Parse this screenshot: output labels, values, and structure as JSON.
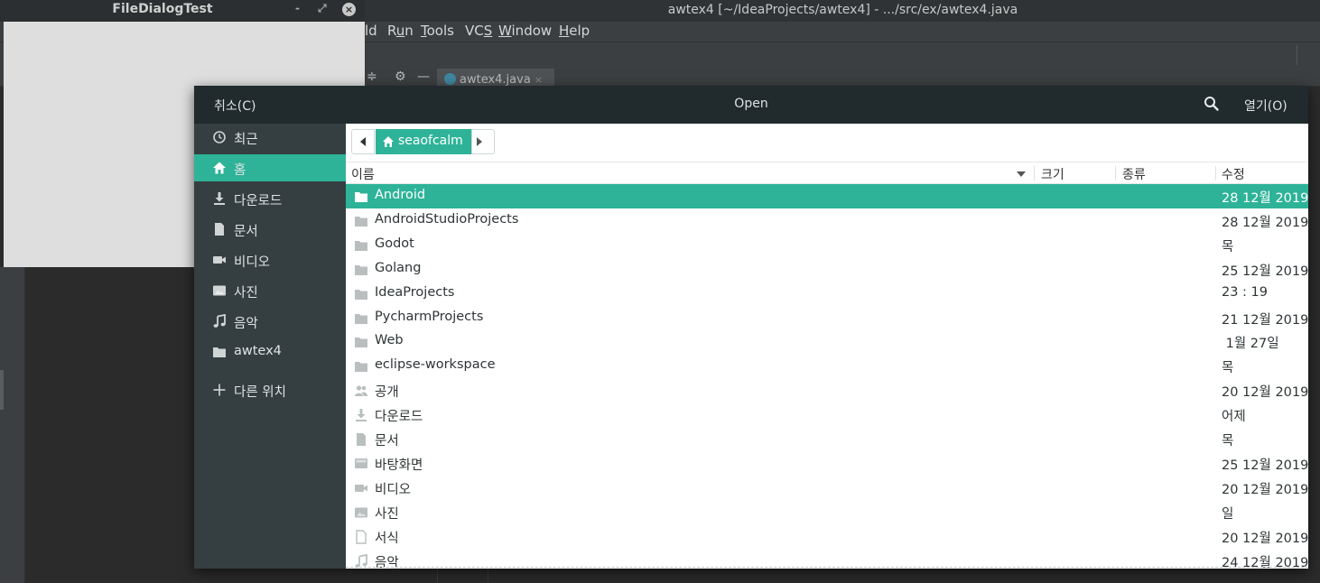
{
  "ide": {
    "title": "awtex4 [~/IdeaProjects/awtex4] - .../src/ex/awtex4.java",
    "menu": [
      {
        "label": "ld",
        "underline": ""
      },
      {
        "pre": "R",
        "u": "u",
        "post": "n"
      },
      {
        "pre": "",
        "u": "T",
        "post": "ools"
      },
      {
        "pre": "VC",
        "u": "S",
        "post": ""
      },
      {
        "pre": "",
        "u": "W",
        "post": "indow"
      },
      {
        "pre": "",
        "u": "H",
        "post": "elp"
      }
    ],
    "menu_labels": {
      "build_fragment": "ld",
      "run": "Run",
      "tools": "Tools",
      "vcs": "VCS",
      "window": "Window",
      "help": "Help"
    },
    "editor_tab": "awtex4.java",
    "editor_tab_close": "×"
  },
  "test_window": {
    "title": "FileDialogTest",
    "minimize": "-",
    "restore": "⤢",
    "close": "×"
  },
  "dialog": {
    "cancel_label": "취소(C)",
    "title": "Open",
    "open_label": "열기(O)",
    "sidebar": [
      {
        "label": "최근",
        "icon": "clock-icon"
      },
      {
        "label": "홈",
        "icon": "home-icon",
        "selected": true
      },
      {
        "label": "다운로드",
        "icon": "download-icon"
      },
      {
        "label": "문서",
        "icon": "document-icon"
      },
      {
        "label": "비디오",
        "icon": "video-icon"
      },
      {
        "label": "사진",
        "icon": "image-icon"
      },
      {
        "label": "음악",
        "icon": "music-icon"
      },
      {
        "label": "awtex4",
        "icon": "folder-icon"
      },
      {
        "label": "다른 위치",
        "icon": "plus-icon"
      }
    ],
    "pathbar": {
      "home_label": "seaofcalm"
    },
    "columns": {
      "name": "이름",
      "size": "크기",
      "type": "종류",
      "modified": "수정"
    },
    "files": [
      {
        "name": "Android",
        "modified": "28 12월 2019",
        "icon": "folder-icon",
        "selected": true
      },
      {
        "name": "AndroidStudioProjects",
        "modified": "28 12월 2019",
        "icon": "folder-icon"
      },
      {
        "name": "Godot",
        "modified": "목",
        "icon": "folder-icon"
      },
      {
        "name": "Golang",
        "modified": "25 12월 2019",
        "icon": "folder-icon"
      },
      {
        "name": "IdeaProjects",
        "modified": "23 : 19",
        "icon": "folder-icon"
      },
      {
        "name": "PycharmProjects",
        "modified": "21 12월 2019",
        "icon": "folder-icon"
      },
      {
        "name": "Web",
        "modified": " 1월 27일",
        "icon": "folder-icon"
      },
      {
        "name": "eclipse-workspace",
        "modified": "목",
        "icon": "folder-icon"
      },
      {
        "name": "공개",
        "modified": "20 12월 2019",
        "icon": "public-share-icon"
      },
      {
        "name": "다운로드",
        "modified": "어제",
        "icon": "download-icon"
      },
      {
        "name": "문서",
        "modified": "목",
        "icon": "document-icon"
      },
      {
        "name": "바탕화면",
        "modified": "25 12월 2019",
        "icon": "desktop-icon"
      },
      {
        "name": "비디오",
        "modified": "20 12월 2019",
        "icon": "video-icon"
      },
      {
        "name": "사진",
        "modified": "일",
        "icon": "image-icon"
      },
      {
        "name": "서식",
        "modified": "20 12월 2019",
        "icon": "template-icon"
      },
      {
        "name": "음악",
        "modified": "24 12월 2019",
        "icon": "music-icon"
      }
    ]
  }
}
